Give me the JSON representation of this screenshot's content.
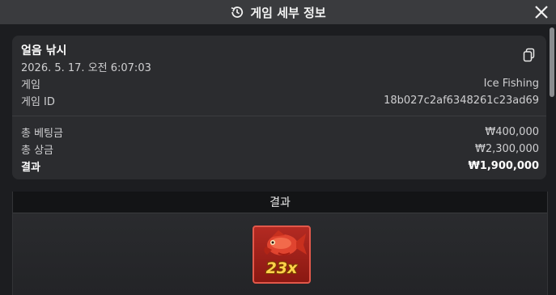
{
  "header": {
    "title": "게임 세부 정보"
  },
  "details": {
    "game_name": "얼음 낚시",
    "datetime": "2026. 5. 17. 오전 6:07:03",
    "game_label": "게임",
    "game_value": "Ice Fishing",
    "game_id_label": "게임 ID",
    "game_id_value": "18b027c2af6348261c23ad69"
  },
  "summary": {
    "total_bet_label": "총 베팅금",
    "total_bet_value": "₩400,000",
    "total_prize_label": "총 상금",
    "total_prize_value": "₩2,300,000",
    "result_label": "결과",
    "result_value": "₩1,900,000"
  },
  "result_section": {
    "title": "결과",
    "tile_multiplier": "23x"
  },
  "colors": {
    "background": "#1b1c1f",
    "titlebar": "#3a3b3e",
    "card": "#2b2c2f",
    "tile": "#b32a22",
    "multiplier": "#ffd24a"
  },
  "icons": {
    "title": "history-icon",
    "close": "close-icon",
    "copy": "copy-icon",
    "tile": "red-fish-icon"
  }
}
